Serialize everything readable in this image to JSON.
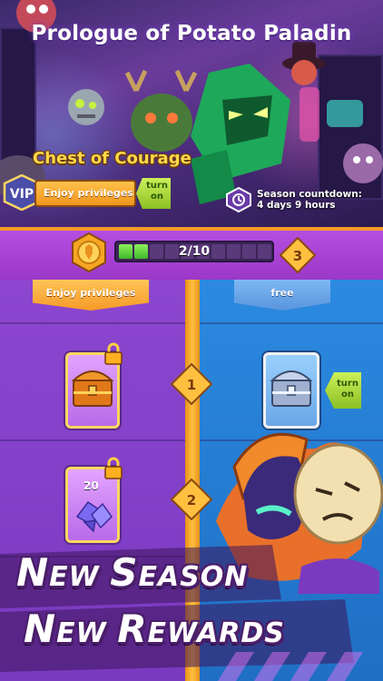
{
  "hero": {
    "title": "Prologue of Potato Paladin",
    "chest_title": "Chest of Courage",
    "vip_label": "VIP",
    "enjoy_privileges": "Enjoy privileges",
    "turn_on": "turn\non",
    "countdown_line1": "Season countdown:",
    "countdown_line2": "4 days 9 hours"
  },
  "progress": {
    "current": 2,
    "total": 10,
    "label": "2/10",
    "level": "3",
    "medal_icon": "pass-medal-icon"
  },
  "columns": {
    "left_header": "Enjoy privileges",
    "right_header": "free"
  },
  "rewards": [
    {
      "tier": "1",
      "premium_icon": "gold-chest-icon",
      "premium_locked": true,
      "free_icon": "silver-chest-icon",
      "free_button": "turn\non"
    },
    {
      "tier": "2",
      "premium_icon": "purple-gems-icon",
      "premium_count": "20",
      "premium_locked": true
    }
  ],
  "banner": {
    "line1_big1": "N",
    "line1_small1": "EW ",
    "line1_big2": "S",
    "line1_small2": "EASON",
    "line2_big1": "N",
    "line2_small1": "EW ",
    "line2_big2": "R",
    "line2_small2": "EWARDS"
  },
  "colors": {
    "accent_orange": "#f59a28",
    "premium_purple": "#8c46d0",
    "free_blue": "#2b8ae0",
    "turn_on_green": "#8bc023"
  }
}
